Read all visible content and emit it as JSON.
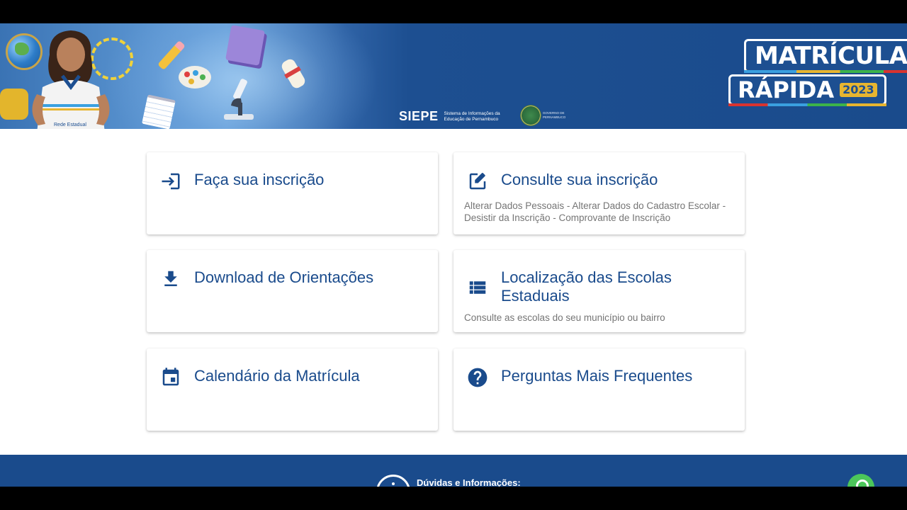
{
  "banner": {
    "siepe_logo": "SIEPE",
    "siepe_description": "Sistema de Informações da Educação de Pernambuco",
    "gov_text": "GOVERNO DE PERNAMBUCO",
    "promo_line1": "MATRÍCULA",
    "promo_line2": "RÁPIDA",
    "promo_year": "2023",
    "shirt_text": "Rede Estadual"
  },
  "cards": [
    {
      "title": "Faça sua inscrição",
      "subtitle": "",
      "icon": "login-icon"
    },
    {
      "title": "Consulte sua inscrição",
      "subtitle": "Alterar Dados Pessoais - Alterar Dados do Cadastro Escolar - Desistir da Inscrição - Comprovante de Inscrição",
      "icon": "edit-icon"
    },
    {
      "title": "Download de Orientações",
      "subtitle": "",
      "icon": "download-icon"
    },
    {
      "title": "Localização das Escolas Estaduais",
      "subtitle": "Consulte as escolas do seu município ou bairro",
      "icon": "list-icon"
    },
    {
      "title": "Calendário da Matrícula",
      "subtitle": "",
      "icon": "calendar-icon"
    },
    {
      "title": "Perguntas Mais Frequentes",
      "subtitle": "",
      "icon": "help-icon"
    }
  ],
  "footer": {
    "info_title": "Dúvidas e Informações:"
  },
  "colors": {
    "primary": "#1a4b8c",
    "subtitle": "#757575",
    "accent_yellow": "#e7b530",
    "whatsapp": "#4cc65a"
  }
}
